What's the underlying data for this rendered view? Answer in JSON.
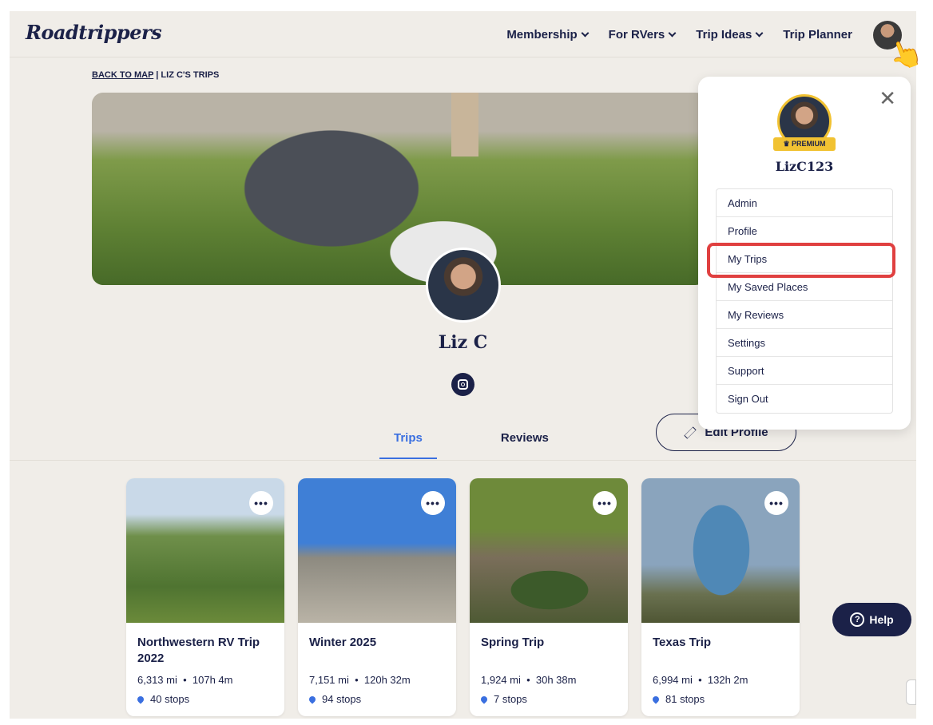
{
  "header": {
    "logo": "Roadtrippers",
    "nav": [
      {
        "label": "Membership",
        "dropdown": true
      },
      {
        "label": "For RVers",
        "dropdown": true
      },
      {
        "label": "Trip Ideas",
        "dropdown": true
      },
      {
        "label": "Trip Planner",
        "dropdown": false
      }
    ]
  },
  "breadcrumb": {
    "back": "BACK TO MAP",
    "separator": " | ",
    "current": "LIZ C'S TRIPS"
  },
  "profile": {
    "name": "Liz C"
  },
  "tabs": [
    {
      "label": "Trips",
      "active": true
    },
    {
      "label": "Reviews",
      "active": false
    }
  ],
  "edit_profile": "Edit Profile",
  "trips": [
    {
      "title": "Northwestern RV Trip 2022",
      "distance": "6,313 mi",
      "duration": "107h 4m",
      "stops": "40 stops"
    },
    {
      "title": "Winter 2025",
      "distance": "7,151 mi",
      "duration": "120h 32m",
      "stops": "94 stops"
    },
    {
      "title": "Spring Trip",
      "distance": "1,924 mi",
      "duration": "30h 38m",
      "stops": "7 stops"
    },
    {
      "title": "Texas Trip",
      "distance": "6,994 mi",
      "duration": "132h 2m",
      "stops": "81 stops"
    }
  ],
  "menu": {
    "badge": "PREMIUM",
    "username": "LizC123",
    "items": [
      "Admin",
      "Profile",
      "My Trips",
      "My Saved Places",
      "My Reviews",
      "Settings",
      "Support",
      "Sign Out"
    ],
    "highlighted": "My Trips"
  },
  "help": "Help",
  "colors": {
    "navy": "#1b2148",
    "accent": "#3a6fe0",
    "highlight": "#e04040",
    "premium": "#f1c232",
    "background": "#f0ede8"
  },
  "icons": [
    "chevron-down-icon",
    "close-icon",
    "instagram-icon",
    "pencil-icon",
    "more-icon",
    "map-pin-icon",
    "help-icon",
    "pointer-hand-icon",
    "crown-icon"
  ]
}
